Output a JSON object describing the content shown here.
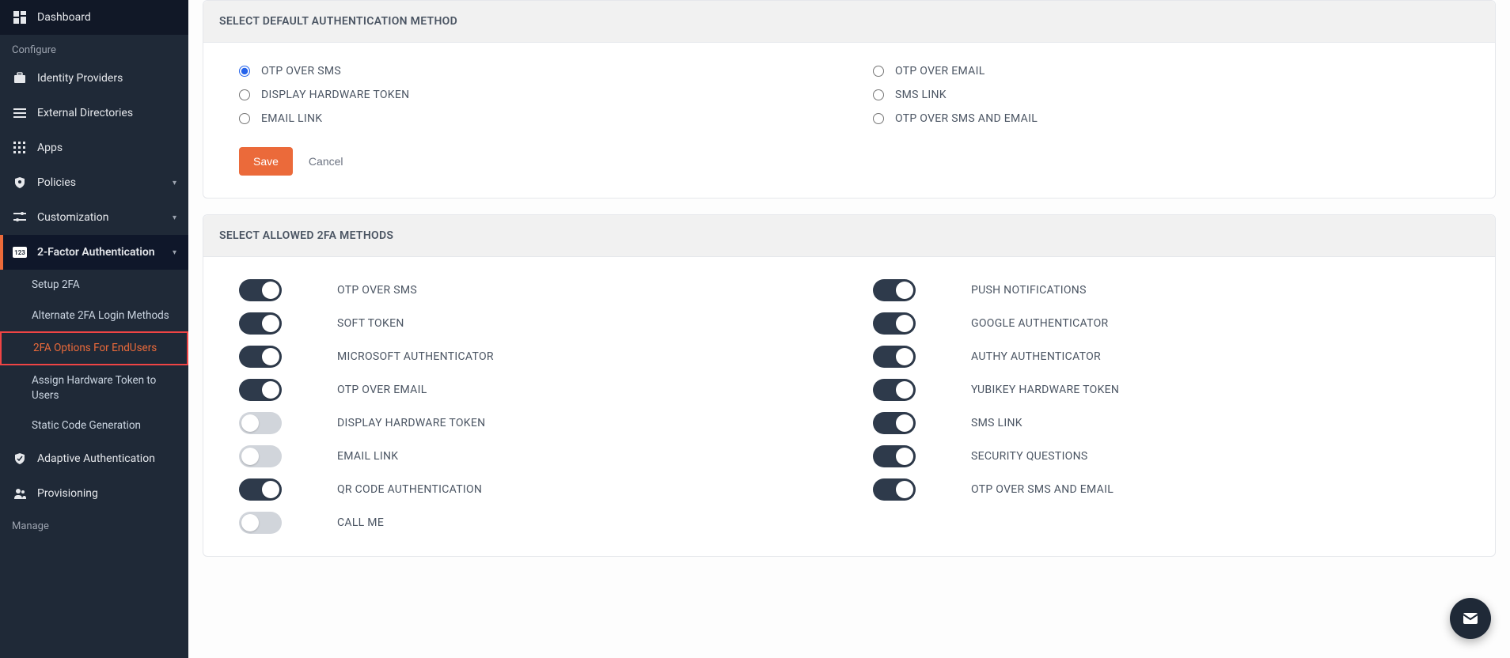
{
  "sidebar": {
    "items": [
      {
        "label": "Dashboard",
        "icon": "dashboard-icon"
      },
      {
        "section": "Configure"
      },
      {
        "label": "Identity Providers",
        "icon": "briefcase-icon"
      },
      {
        "label": "External Directories",
        "icon": "list-icon"
      },
      {
        "label": "Apps",
        "icon": "grid-icon"
      },
      {
        "label": "Policies",
        "icon": "shield-icon",
        "expandable": true
      },
      {
        "label": "Customization",
        "icon": "sliders-icon",
        "expandable": true
      },
      {
        "label": "2-Factor Authentication",
        "icon": "badge-icon",
        "expandable": true,
        "active": true
      },
      {
        "label": "Adaptive Authentication",
        "icon": "shield-check-icon"
      },
      {
        "label": "Provisioning",
        "icon": "users-icon"
      },
      {
        "section": "Manage"
      }
    ],
    "sub_items": [
      "Setup 2FA",
      "Alternate 2FA Login Methods",
      "2FA Options For EndUsers",
      "Assign Hardware Token to Users",
      "Static Code Generation"
    ],
    "highlighted_sub": 2
  },
  "default_method": {
    "title": "SELECT DEFAULT AUTHENTICATION METHOD",
    "left": [
      {
        "label": "OTP OVER SMS",
        "checked": true
      },
      {
        "label": "DISPLAY HARDWARE TOKEN",
        "checked": false
      },
      {
        "label": "EMAIL LINK",
        "checked": false
      }
    ],
    "right": [
      {
        "label": "OTP OVER EMAIL",
        "checked": false
      },
      {
        "label": "SMS LINK",
        "checked": false
      },
      {
        "label": "OTP OVER SMS AND EMAIL",
        "checked": false
      }
    ],
    "save_label": "Save",
    "cancel_label": "Cancel"
  },
  "allowed_methods": {
    "title": "SELECT ALLOWED 2FA METHODS",
    "left": [
      {
        "label": "OTP OVER SMS",
        "on": true
      },
      {
        "label": "SOFT TOKEN",
        "on": true
      },
      {
        "label": "MICROSOFT AUTHENTICATOR",
        "on": true
      },
      {
        "label": "OTP OVER EMAIL",
        "on": true
      },
      {
        "label": "DISPLAY HARDWARE TOKEN",
        "on": false
      },
      {
        "label": "EMAIL LINK",
        "on": false
      },
      {
        "label": "QR CODE AUTHENTICATION",
        "on": true
      },
      {
        "label": "CALL ME",
        "on": false
      }
    ],
    "right": [
      {
        "label": "PUSH NOTIFICATIONS",
        "on": true
      },
      {
        "label": "GOOGLE AUTHENTICATOR",
        "on": true
      },
      {
        "label": "AUTHY AUTHENTICATOR",
        "on": true
      },
      {
        "label": "YUBIKEY HARDWARE TOKEN",
        "on": true
      },
      {
        "label": "SMS LINK",
        "on": true
      },
      {
        "label": "SECURITY QUESTIONS",
        "on": true
      },
      {
        "label": "OTP OVER SMS AND EMAIL",
        "on": true
      }
    ]
  }
}
